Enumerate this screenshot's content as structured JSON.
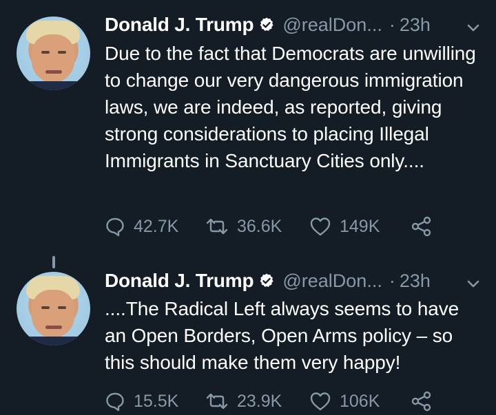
{
  "tweets": [
    {
      "author_name": "Donald J. Trump",
      "author_handle": "@realDon...",
      "separator": "·",
      "time": "23h",
      "text": "Due to the fact that Democrats are unwilling to change our very dangerous immigration laws, we are indeed, as reported, giving strong considerations to placing Illegal Immigrants in Sanctuary Cities only....",
      "reply_count": "42.7K",
      "retweet_count": "36.6K",
      "like_count": "149K"
    },
    {
      "author_name": "Donald J. Trump",
      "author_handle": "@realDon...",
      "separator": "·",
      "time": "23h",
      "text": "....The Radical Left always seems to have an Open Borders, Open Arms policy – so this should make them very happy!",
      "reply_count": "15.5K",
      "retweet_count": "23.9K",
      "like_count": "106K"
    }
  ],
  "colors": {
    "background": "#141d26",
    "text": "#ffffff",
    "secondary": "#8899a6"
  },
  "icons": [
    "verified-badge-icon",
    "chevron-down-icon",
    "reply-icon",
    "retweet-icon",
    "like-icon",
    "share-icon"
  ]
}
